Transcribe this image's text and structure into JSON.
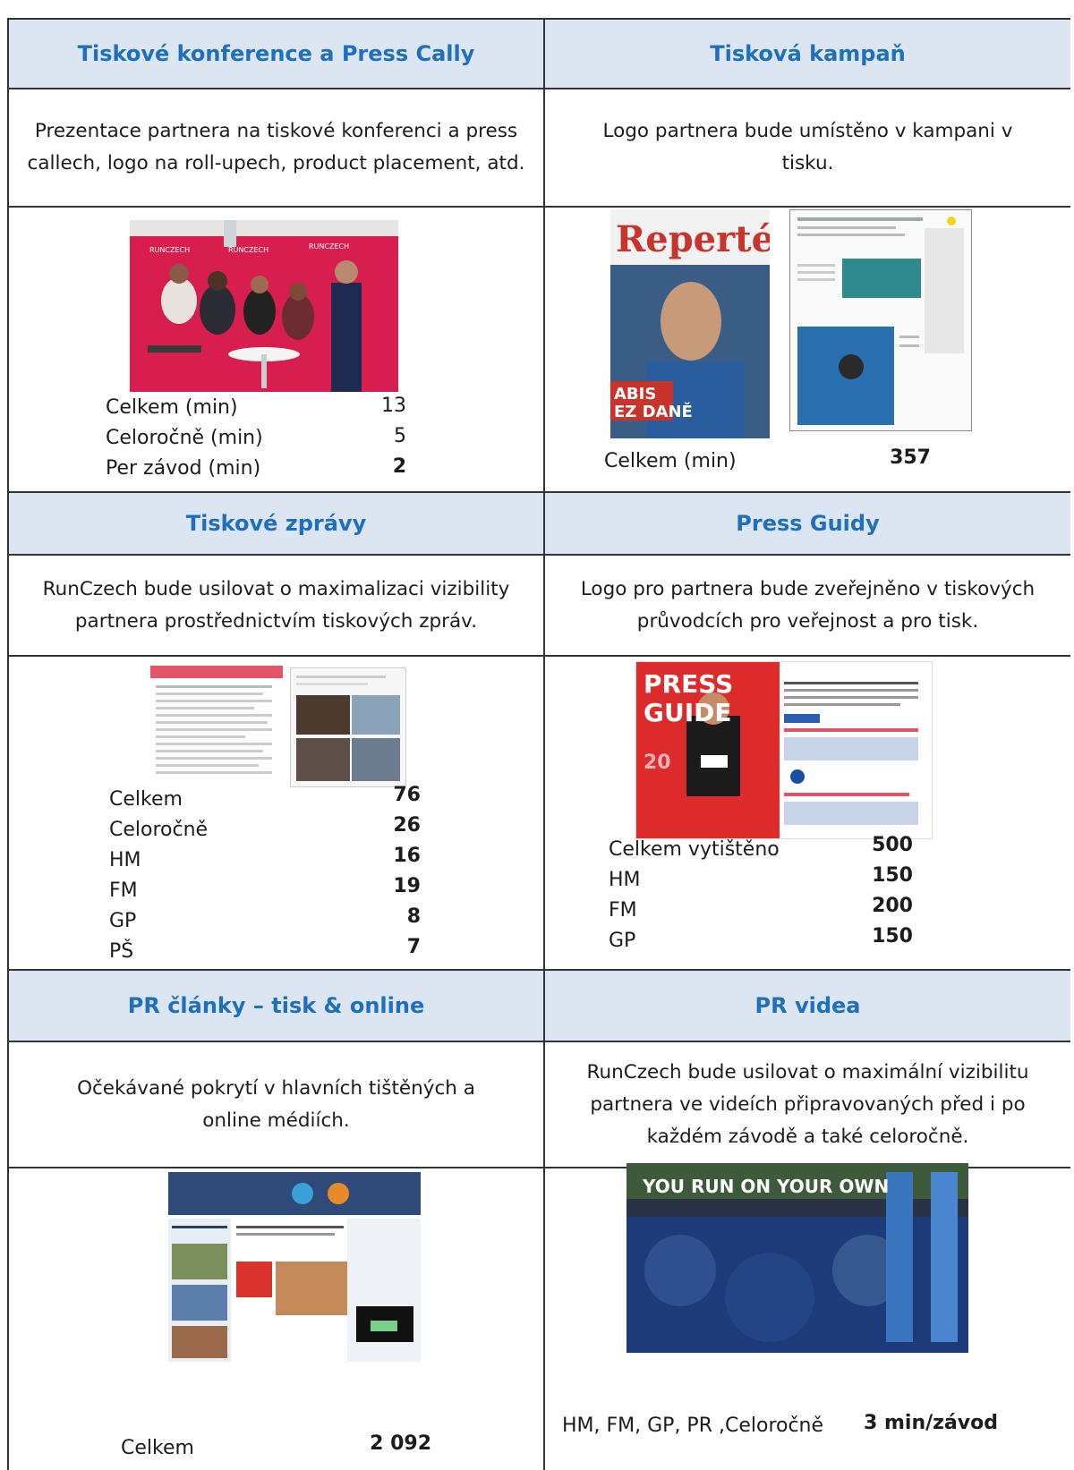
{
  "sections": [
    {
      "title": "Tiskové konference a Press Cally",
      "description": "Prezentace partnera na tiskové konferenci a press callech, logo na roll-upech, product placement, atd.",
      "image": "press-conference-photo",
      "stats": [
        {
          "label": "Celkem (min)",
          "value": "13"
        },
        {
          "label": "Celoročně (min)",
          "value": "5"
        },
        {
          "label": "Per závod (min)",
          "value": "2"
        }
      ]
    },
    {
      "title": "Tisková kampaň",
      "description": "Logo partnera bude umístěno v kampani v tisku.",
      "image": "magazine-covers",
      "image_text": [
        "Repertér",
        "ABIS",
        "EZ DANĚ"
      ],
      "stats": [
        {
          "label": "Celkem (min)",
          "value": "357"
        }
      ]
    },
    {
      "title": "Tiskové zprávy",
      "description": "RunCzech bude usilovat o maximalizaci vizibility partnera prostřednictvím tiskových zpráv.",
      "image": "press-release-documents",
      "stats": [
        {
          "label": "Celkem",
          "value": "76"
        },
        {
          "label": "Celoročně",
          "value": "26"
        },
        {
          "label": "HM",
          "value": "16"
        },
        {
          "label": "FM",
          "value": "19"
        },
        {
          "label": "GP",
          "value": "8"
        },
        {
          "label": "PŠ",
          "value": "7"
        }
      ]
    },
    {
      "title": "Press Guidy",
      "description": "Logo pro partnera bude zveřejněno v tiskových průvodcích pro veřejnost a pro tisk.",
      "image": "press-guide-cover",
      "image_text": [
        "PRESS",
        "GUIDE",
        "20"
      ],
      "stats": [
        {
          "label": "Celkem vytištěno",
          "value": "500"
        },
        {
          "label": "HM",
          "value": "150"
        },
        {
          "label": "FM",
          "value": "200"
        },
        {
          "label": "GP",
          "value": "150"
        }
      ]
    },
    {
      "title": "PR články – tisk & online",
      "description": "Očekávané pokrytí v hlavních tištěných a online médiích.",
      "image": "online-articles-collage",
      "stats": [
        {
          "label": "Celkem",
          "value": "2 092"
        }
      ]
    },
    {
      "title": "PR videa",
      "description": "RunCzech bude usilovat o maximální vizibilitu partnera ve videích připravovaných před i po každém závodě a také celoročně.",
      "image": "race-start-video-still",
      "image_text": [
        "YOU RUN ON YOUR OWN"
      ],
      "stats": [
        {
          "label": "HM, FM, GP, PR ,Celoročně",
          "value": "3 min/závod"
        }
      ]
    }
  ],
  "colors": {
    "header_bg": "#dce6f2",
    "header_text": "#1f6fbf",
    "border": "#333333",
    "photo_red": "#d81e4f"
  }
}
